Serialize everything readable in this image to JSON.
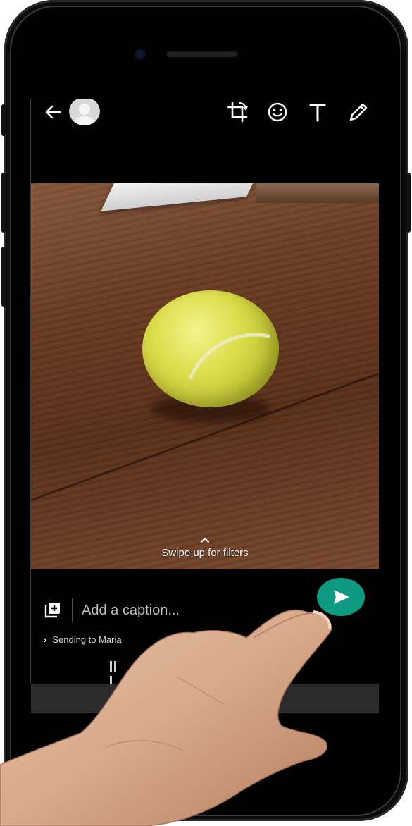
{
  "screen": {
    "topbar": {
      "back_icon": "arrow-left-icon",
      "avatar_icon": "default-contact-avatar",
      "tools": [
        "crop-rotate-icon",
        "emoji-icon",
        "text-icon",
        "pencil-icon"
      ]
    },
    "photo": {
      "subject": "",
      "ball_text": "",
      "filter_hint": "Swipe up for filters"
    },
    "caption": {
      "placeholder": "Add a caption...",
      "add_media_icon": "add-media-icon",
      "send_icon": "send-icon"
    },
    "recipient": {
      "text": "Sending to Maria"
    }
  },
  "colors": {
    "accent": "#0d9a80",
    "background": "#000000"
  }
}
